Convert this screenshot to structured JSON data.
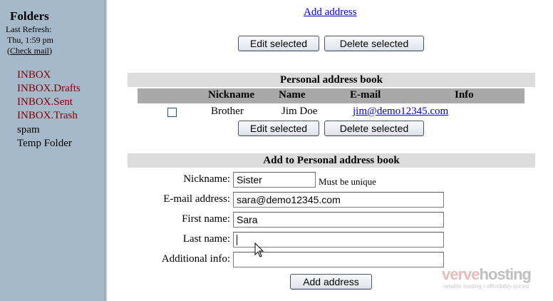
{
  "sidebar": {
    "title": "Folders",
    "last_refresh_label": "Last Refresh:",
    "last_refresh_time": "Thu, 1:59 pm",
    "check_mail_open": "(",
    "check_mail_label": "Check mail",
    "check_mail_close": ")",
    "folders": [
      {
        "label": "INBOX",
        "color": "#800000"
      },
      {
        "label": "INBOX.Drafts",
        "color": "#800000"
      },
      {
        "label": "INBOX.Sent",
        "color": "#800000"
      },
      {
        "label": "INBOX.Trash",
        "color": "#800000"
      },
      {
        "label": "spam",
        "color": "#000000"
      },
      {
        "label": "Temp Folder",
        "color": "#000000"
      }
    ]
  },
  "top": {
    "add_address_link": "Add address",
    "edit_selected": "Edit selected",
    "delete_selected": "Delete selected"
  },
  "personal_book": {
    "title": "Personal address book",
    "columns": [
      "Nickname",
      "Name",
      "E-mail",
      "Info"
    ],
    "rows": [
      {
        "nickname": "Brother",
        "name": "Jim Doe",
        "email": "jim@demo12345.com",
        "info": "",
        "checked": false
      }
    ],
    "edit_selected": "Edit selected",
    "delete_selected": "Delete selected"
  },
  "add_form": {
    "title": "Add to Personal address book",
    "nickname_label": "Nickname:",
    "nickname_value": "Sister",
    "nickname_hint": "Must be unique",
    "email_label": "E-mail address:",
    "email_value": "sara@demo12345.com",
    "first_name_label": "First name:",
    "first_name_value": "Sara",
    "last_name_label": "Last name:",
    "last_name_value": "",
    "info_label": "Additional info:",
    "info_value": "",
    "submit_label": "Add address"
  },
  "watermark": {
    "brand_part1": "verve",
    "brand_part2": "hosting",
    "tagline": "reliable hosting • affordably priced"
  },
  "colors": {
    "sidebar_bg": "#a5b9cb",
    "folder_link": "#800000",
    "link": "#0000cc",
    "section_header_bg": "#dcdcdc",
    "table_header_bg": "#a9a9a9"
  }
}
